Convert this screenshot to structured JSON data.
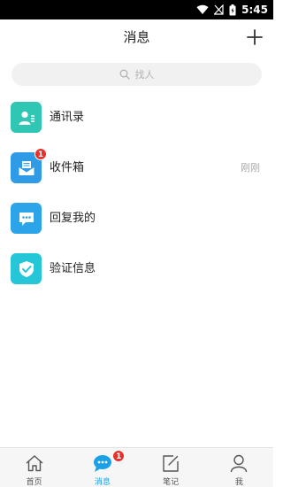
{
  "status_bar": {
    "time": "5:45"
  },
  "header": {
    "title": "消息"
  },
  "search": {
    "placeholder": "找人"
  },
  "list": {
    "items": [
      {
        "label": "通讯录",
        "icon": "contacts-icon",
        "color": "#2fc7b3",
        "time": "",
        "badge": ""
      },
      {
        "label": "收件箱",
        "icon": "inbox-icon",
        "color": "#2f9ae6",
        "time": "刚刚",
        "badge": "1"
      },
      {
        "label": "回复我的",
        "icon": "reply-bubble-icon",
        "color": "#2ba4ea",
        "time": "",
        "badge": ""
      },
      {
        "label": "验证信息",
        "icon": "shield-check-icon",
        "color": "#25c6d8",
        "time": "",
        "badge": ""
      }
    ]
  },
  "tabbar": {
    "tabs": [
      {
        "label": "首页",
        "icon": "home-icon",
        "active": false
      },
      {
        "label": "消息",
        "icon": "chat-bubble-icon",
        "active": true,
        "badge": "1"
      },
      {
        "label": "笔记",
        "icon": "note-edit-icon",
        "active": false
      },
      {
        "label": "我",
        "icon": "person-icon",
        "active": false
      }
    ]
  },
  "colors": {
    "accent": "#1aa0e6",
    "badge": "#e8312c"
  }
}
